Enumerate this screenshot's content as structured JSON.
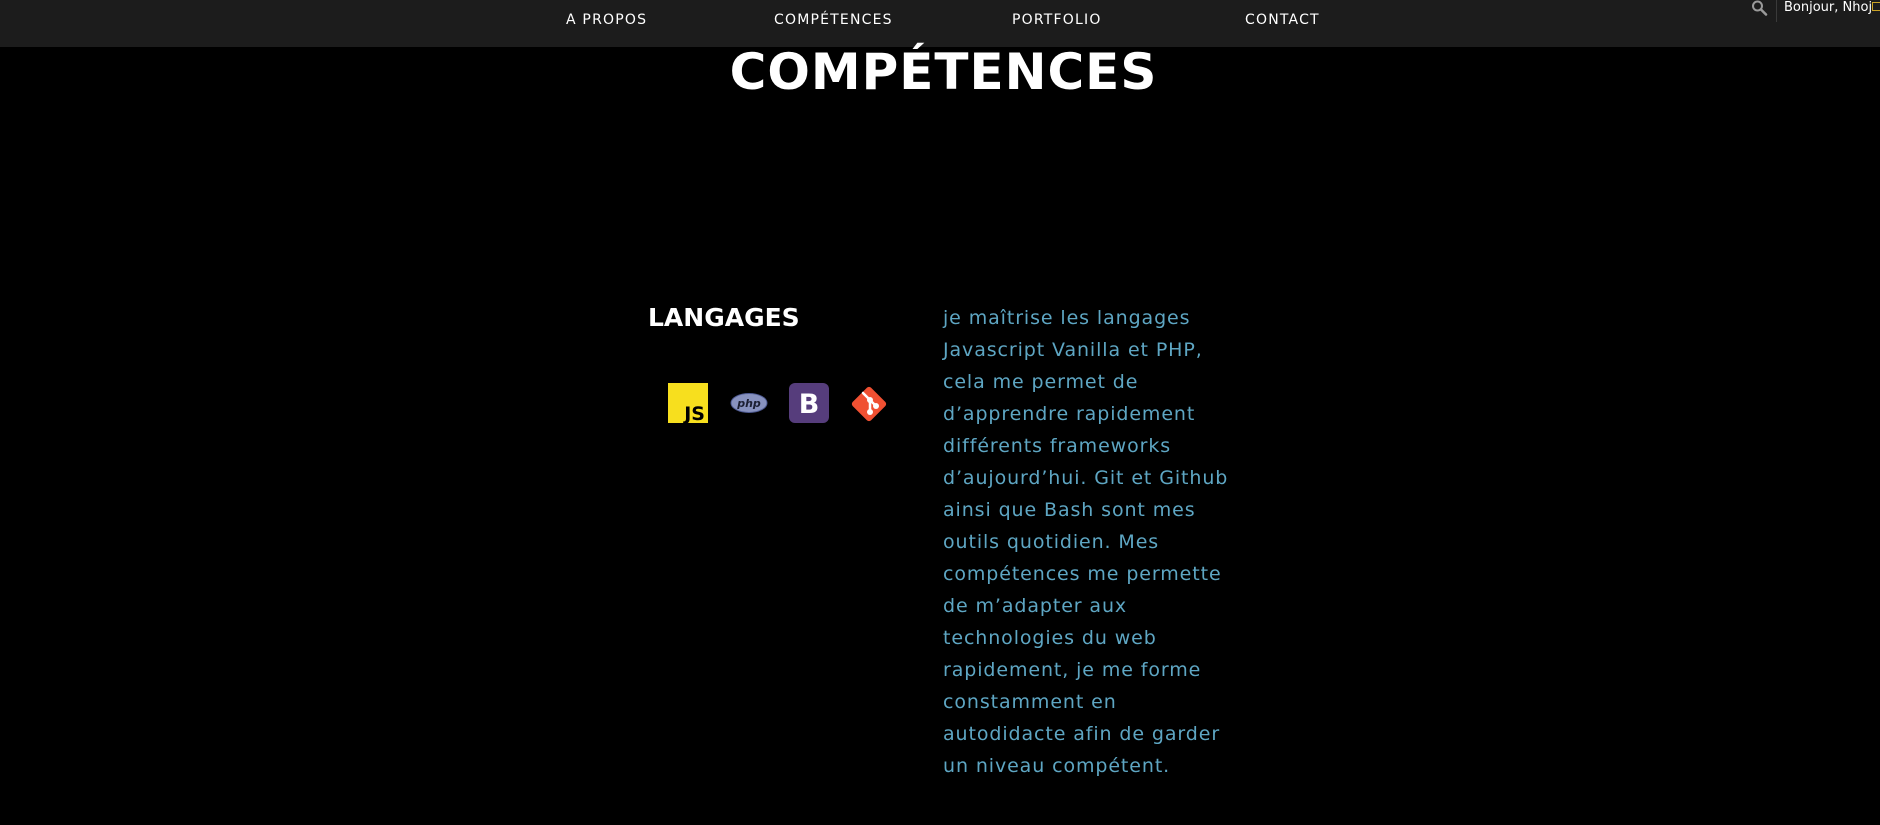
{
  "nav": {
    "items": [
      {
        "label": "A PROPOS"
      },
      {
        "label": "COMPÉTENCES"
      },
      {
        "label": "PORTFOLIO"
      },
      {
        "label": "CONTACT"
      }
    ],
    "search_icon": "search-icon",
    "greeting": "Bonjour, Nhoj"
  },
  "main": {
    "title": "COMPÉTENCES",
    "section_heading": "LANGAGES",
    "icons": [
      {
        "name": "javascript-icon",
        "text": "JS",
        "color": "#f7df1e"
      },
      {
        "name": "php-icon",
        "text": "php",
        "color": "#8892bf"
      },
      {
        "name": "bootstrap-icon",
        "text": "B",
        "color": "#563d7c"
      },
      {
        "name": "git-icon",
        "color": "#f05032"
      }
    ],
    "description_lines": [
      "je maîtrise les langages",
      "Javascript Vanilla et PHP,",
      "cela me permet de",
      "d’apprendre rapidement",
      "différents frameworks",
      "d’aujourd’hui. Git et Github",
      "ainsi que Bash sont mes",
      "outils quotidien. Mes",
      "compétences me permette",
      "de m’adapter aux",
      "technologies du web",
      "rapidement, je me forme",
      "constamment en",
      "autodidacte afin de garder",
      "un niveau compétent."
    ]
  },
  "colors": {
    "background": "#000000",
    "topbar": "#1c1c1c",
    "text": "#ffffff",
    "accent_text": "#5ea6c3"
  }
}
